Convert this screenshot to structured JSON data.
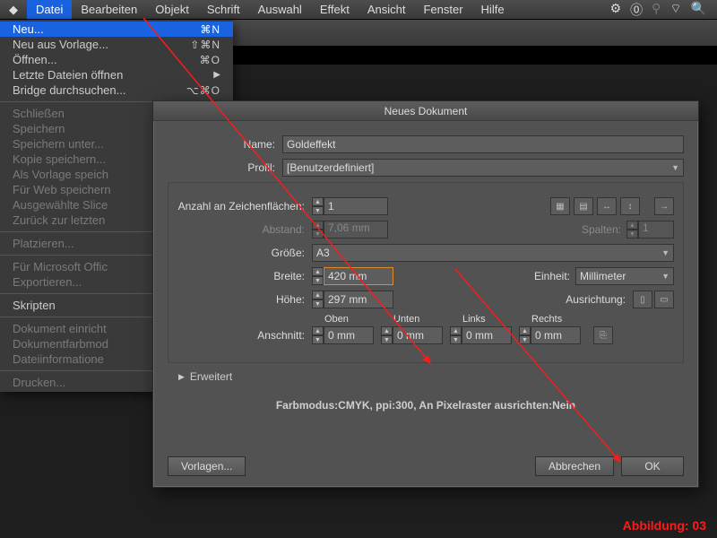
{
  "menubar": {
    "items": [
      "AI",
      "Datei",
      "Bearbeiten",
      "Objekt",
      "Schrift",
      "Auswahl",
      "Effekt",
      "Ansicht",
      "Fenster",
      "Hilfe"
    ],
    "active_index": 1
  },
  "dropdown": {
    "groups": [
      [
        {
          "label": "Neu...",
          "shortcut": "⌘N",
          "highlight": true
        },
        {
          "label": "Neu aus Vorlage...",
          "shortcut": "⇧⌘N"
        },
        {
          "label": "Öffnen...",
          "shortcut": "⌘O"
        },
        {
          "label": "Letzte Dateien öffnen",
          "submenu": true
        },
        {
          "label": "Bridge durchsuchen...",
          "shortcut": "⌥⌘O"
        }
      ],
      [
        {
          "label": "Schließen",
          "disabled": true
        },
        {
          "label": "Speichern",
          "disabled": true
        },
        {
          "label": "Speichern unter...",
          "disabled": true
        },
        {
          "label": "Kopie speichern...",
          "disabled": true
        },
        {
          "label": "Als Vorlage speich",
          "disabled": true
        },
        {
          "label": "Für Web speichern",
          "disabled": true
        },
        {
          "label": "Ausgewählte Slice",
          "disabled": true
        },
        {
          "label": "Zurück zur letzten",
          "disabled": true
        }
      ],
      [
        {
          "label": "Platzieren...",
          "disabled": true
        }
      ],
      [
        {
          "label": "Für Microsoft Offic",
          "disabled": true
        },
        {
          "label": "Exportieren...",
          "disabled": true
        }
      ],
      [
        {
          "label": "Skripten"
        }
      ],
      [
        {
          "label": "Dokument einricht",
          "disabled": true
        },
        {
          "label": "Dokumentfarbmod",
          "disabled": true
        },
        {
          "label": "Dateiinformatione",
          "disabled": true
        }
      ],
      [
        {
          "label": "Drucken...",
          "disabled": true
        }
      ]
    ]
  },
  "dialog": {
    "title": "Neues Dokument",
    "name_label": "Name:",
    "name_value": "Goldeffekt",
    "profile_label": "Profil:",
    "profile_value": "[Benutzerdefiniert]",
    "artboards_label": "Anzahl an Zeichenflächen:",
    "artboards_value": "1",
    "spacing_label": "Abstand:",
    "spacing_value": "7,06 mm",
    "columns_label": "Spalten:",
    "columns_value": "1",
    "size_label": "Größe:",
    "size_value": "A3",
    "width_label": "Breite:",
    "width_value": "420 mm",
    "height_label": "Höhe:",
    "height_value": "297 mm",
    "unit_label": "Einheit:",
    "unit_value": "Millimeter",
    "orient_label": "Ausrichtung:",
    "bleed_label": "Anschnitt:",
    "bleed_heads": [
      "Oben",
      "Unten",
      "Links",
      "Rechts"
    ],
    "bleed_value": "0 mm",
    "advanced_label": "Erweitert",
    "summary": "Farbmodus:CMYK, ppi:300, An Pixelraster ausrichten:Nein",
    "btn_templates": "Vorlagen...",
    "btn_cancel": "Abbrechen",
    "btn_ok": "OK"
  },
  "caption": "Abbildung: 03"
}
